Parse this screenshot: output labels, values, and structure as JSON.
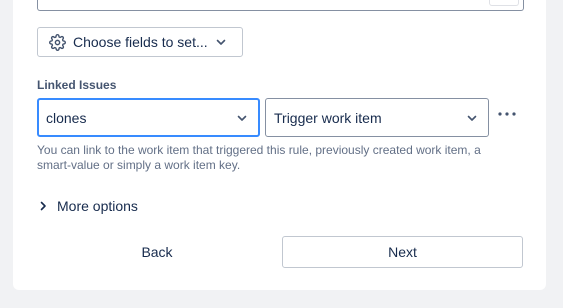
{
  "choose_fields": {
    "label": "Choose fields to set...",
    "icon": "gear-icon"
  },
  "linked_issues": {
    "label": "Linked Issues",
    "link_type": {
      "value": "clones"
    },
    "target": {
      "value": "Trigger work item"
    },
    "helper_line1": "You can link to the work item that triggered this rule, previously created work item, a",
    "helper_line2": "smart-value or simply a work item key."
  },
  "more_options": {
    "label": "More options"
  },
  "footer": {
    "back_label": "Back",
    "next_label": "Next"
  },
  "colors": {
    "focus": "#388bff",
    "background": "#f1f2f4"
  }
}
